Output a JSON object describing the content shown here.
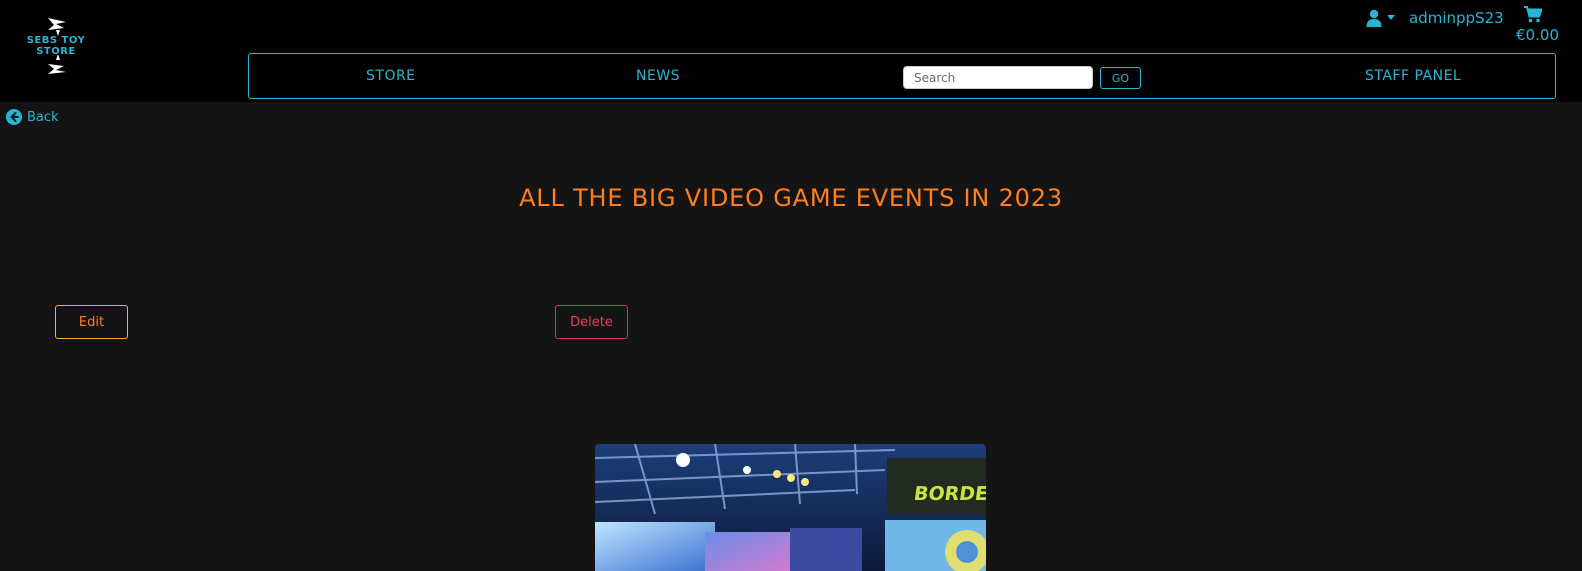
{
  "header": {
    "logo_text": "SEBS TOY STORE",
    "username": "adminppS23",
    "cart_total": "€0.00"
  },
  "nav": {
    "items": [
      "STORE",
      "NEWS",
      "STAFF PANEL"
    ],
    "search_placeholder": "Search",
    "go_label": "GO"
  },
  "page": {
    "back_label": "Back",
    "title": "ALL THE BIG VIDEO GAME EVENTS IN 2023",
    "edit_label": "Edit",
    "delete_label": "Delete"
  },
  "colors": {
    "accent": "#26b6d4",
    "title": "#ff7f1a",
    "edit_border": "#ffb020",
    "delete": "#dc3545",
    "background": "#141414",
    "header": "#000000"
  },
  "icons": [
    "user-icon",
    "caret-down-icon",
    "cart-icon",
    "back-arrow-icon"
  ]
}
